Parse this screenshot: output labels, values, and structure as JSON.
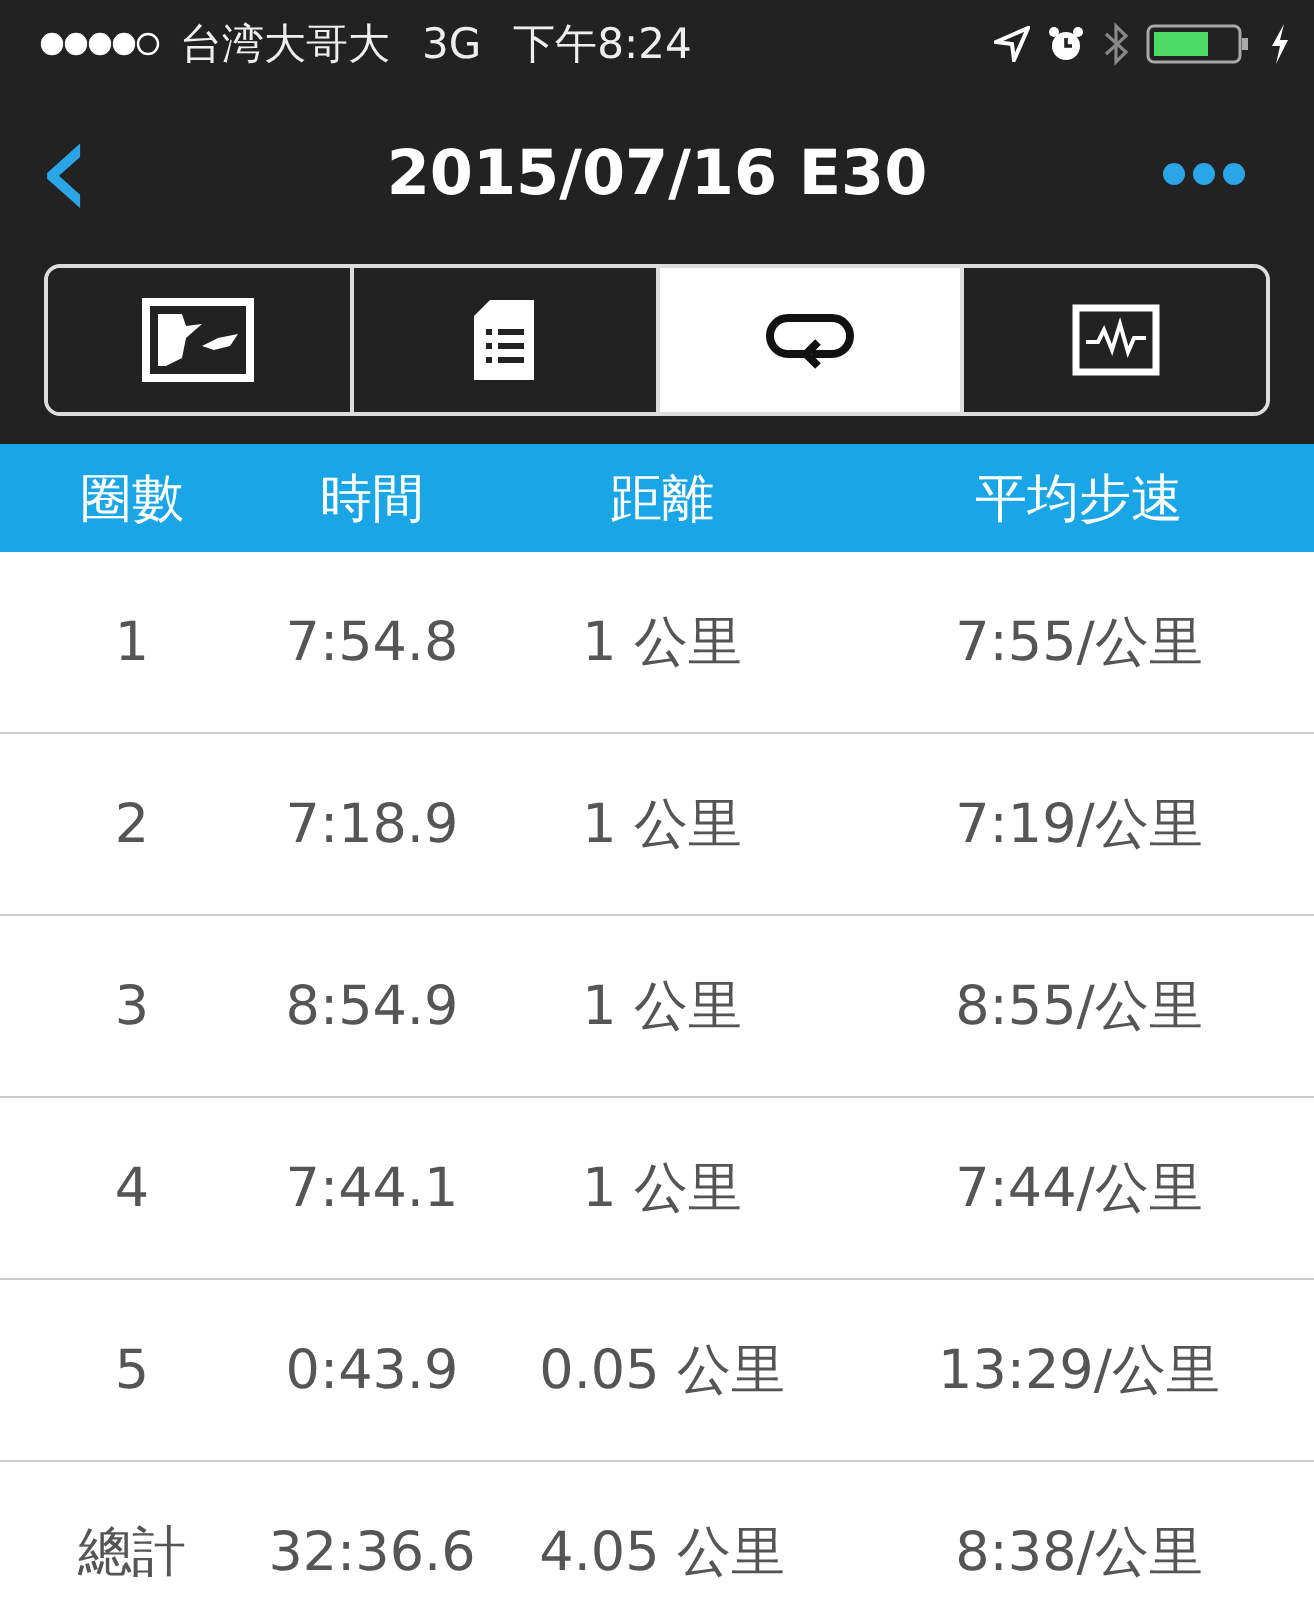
{
  "status_bar": {
    "carrier": "台湾大哥大",
    "network": "3G",
    "time": "下午8:24"
  },
  "nav": {
    "back": "‹",
    "title": "2015/07/16 E30"
  },
  "tabs": [
    {
      "kind": "map",
      "selected": false
    },
    {
      "kind": "document",
      "selected": false
    },
    {
      "kind": "laps",
      "selected": true
    },
    {
      "kind": "chart",
      "selected": false
    }
  ],
  "table": {
    "columns": [
      "圈數",
      "時間",
      "距離",
      "平均步速"
    ],
    "rows": [
      [
        "1",
        "7:54.8",
        "1 公里",
        "7:55/公里"
      ],
      [
        "2",
        "7:18.9",
        "1 公里",
        "7:19/公里"
      ],
      [
        "3",
        "8:54.9",
        "1 公里",
        "8:55/公里"
      ],
      [
        "4",
        "7:44.1",
        "1 公里",
        "7:44/公里"
      ],
      [
        "5",
        "0:43.9",
        "0.05 公里",
        "13:29/公里"
      ],
      [
        "總計",
        "32:36.6",
        "4.05 公里",
        "8:38/公里"
      ]
    ]
  }
}
